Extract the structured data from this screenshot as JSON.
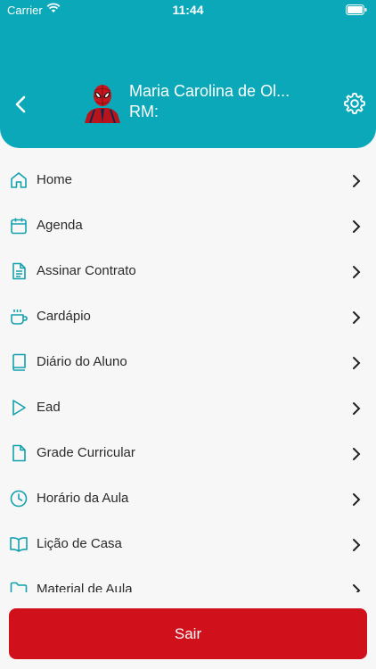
{
  "status_bar": {
    "carrier": "Carrier",
    "time": "11:44"
  },
  "header": {
    "user_name": "Maria Carolina de Ol...",
    "rm_label": "RM:",
    "background_color": "#0aa8b8"
  },
  "menu": {
    "icon_color": "#13a1ae",
    "items": [
      {
        "label": "Home",
        "icon": "home-icon"
      },
      {
        "label": "Agenda",
        "icon": "calendar-icon"
      },
      {
        "label": "Assinar Contrato",
        "icon": "document-icon"
      },
      {
        "label": "Cardápio",
        "icon": "cup-icon"
      },
      {
        "label": "Diário do Aluno",
        "icon": "book-icon"
      },
      {
        "label": "Ead",
        "icon": "play-icon"
      },
      {
        "label": "Grade Curricular",
        "icon": "file-icon"
      },
      {
        "label": "Horário da Aula",
        "icon": "clock-icon"
      },
      {
        "label": "Lição de Casa",
        "icon": "open-book-icon"
      },
      {
        "label": "Material de Aula",
        "icon": "folder-icon"
      }
    ]
  },
  "footer": {
    "logout_label": "Sair",
    "logout_color": "#d0111c"
  }
}
